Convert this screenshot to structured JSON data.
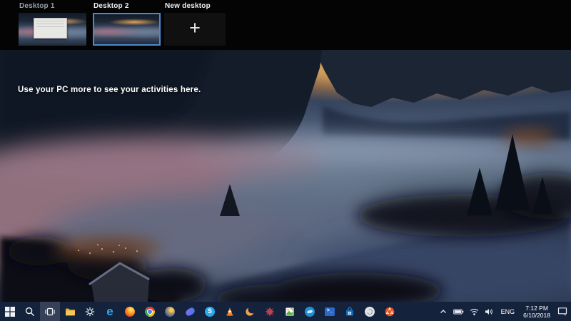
{
  "task_view": {
    "desktop1_label": "Desktop 1",
    "desktop2_label": "Desktop 2",
    "new_desktop_label": "New desktop",
    "plus_glyph": "+",
    "empty_message": "Use your PC more to see your activities here.",
    "selected_desktop": "Desktop 2"
  },
  "taskbar": {
    "icons": [
      "start",
      "search",
      "task-view",
      "file-explorer",
      "settings",
      "edge",
      "firefox",
      "chrome",
      "gimp-sphere-app",
      "purple-swoosh-app",
      "skype",
      "vlc",
      "orange-crescent-app",
      "red-star-app",
      "image-editor-app",
      "blue-circle-app",
      "powershell",
      "microsoft-store",
      "globe-app",
      "ubuntu"
    ],
    "active_icon": "task-view",
    "glyphs": {
      "edge": "e",
      "skype": "S",
      "powershell": ">_"
    },
    "tray": {
      "icons": [
        "hidden-icons-chevron",
        "battery",
        "wifi",
        "volume",
        "language",
        "clock",
        "action-center"
      ],
      "language": "ENG",
      "time": "7:12 PM",
      "date": "6/10/2018"
    }
  },
  "colors": {
    "selection_border": "#4c8ad0",
    "taskbar_bg": "#15223c",
    "topbar_bg": "#040404",
    "message_color": "#ffffff"
  }
}
